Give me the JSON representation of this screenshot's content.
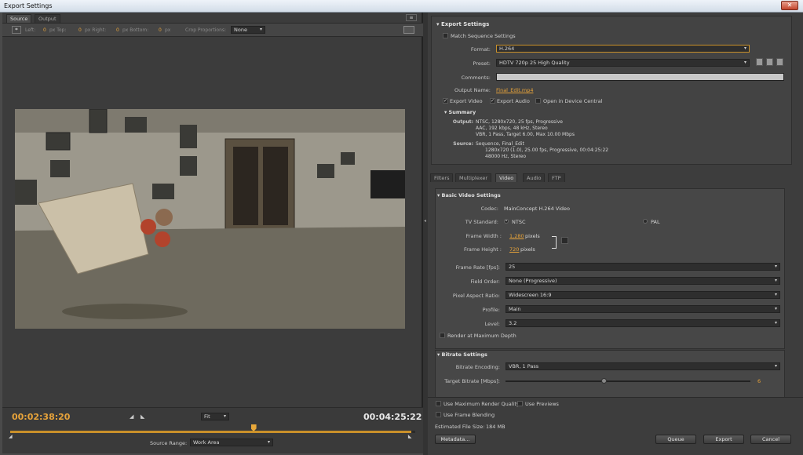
{
  "window": {
    "title": "Export Settings",
    "close": "✕"
  },
  "left": {
    "tabs": [
      "Source",
      "Output"
    ],
    "crop": {
      "left_label": "Left:",
      "left_val": "0",
      "top_label": "px  Top:",
      "top_val": "0",
      "right_label": "px  Right:",
      "right_val": "0",
      "bottom_label": "px  Bottom:",
      "bottom_val": "0",
      "unit": "px",
      "proportions_label": "Crop Proportions:",
      "proportions_val": "None"
    },
    "timecode_current": "00:02:38:20",
    "timecode_total": "00:04:25:22",
    "zoom": "Fit",
    "source_range_label": "Source Range:",
    "source_range_val": "Work Area",
    "playhead_fraction": 0.6,
    "in_fraction": 0.0,
    "out_fraction": 0.99
  },
  "export": {
    "header": "Export Settings",
    "match_sequence": "Match Sequence Settings",
    "format_label": "Format:",
    "format_val": "H.264",
    "preset_label": "Preset:",
    "preset_val": "HDTV 720p 25 High Quality",
    "comments_label": "Comments:",
    "output_name_label": "Output Name:",
    "output_name_val": "Final_Edit.mp4",
    "export_video": "Export Video",
    "export_audio": "Export Audio",
    "open_device": "Open in Device Central",
    "summary_header": "Summary",
    "output_label": "Output:",
    "output_lines": [
      "NTSC, 1280x720, 25 fps, Progressive",
      "AAC, 192 kbps, 48 kHz, Stereo",
      "VBR, 1 Pass, Target 6.00, Max 10.00 Mbps"
    ],
    "source_label": "Source:",
    "source_lines": [
      "Sequence, Final_Edit",
      "1280x720 (1.0), 25.00 fps, Progressive, 00:04:25:22",
      "48000 Hz, Stereo"
    ]
  },
  "tabs2": [
    "Filters",
    "Multiplexer",
    "Video",
    "Audio",
    "FTP"
  ],
  "video": {
    "header": "Basic Video Settings",
    "codec_label": "Codec:",
    "codec_val": "MainConcept H.264 Video",
    "tv_label": "TV Standard:",
    "ntsc": "NTSC",
    "pal": "PAL",
    "fw_label": "Frame Width :",
    "fw_val": "1,280",
    "fh_label": "Frame Height :",
    "fh_val": "720",
    "pixels": "pixels",
    "fr_label": "Frame Rate [fps]:",
    "fr_val": "25",
    "fo_label": "Field Order:",
    "fo_val": "None (Progressive)",
    "par_label": "Pixel Aspect Ratio:",
    "par_val": "Widescreen 16:9",
    "profile_label": "Profile:",
    "profile_val": "Main",
    "level_label": "Level:",
    "level_val": "3.2",
    "render_max": "Render at Maximum Depth"
  },
  "bitrate": {
    "header": "Bitrate Settings",
    "enc_label": "Bitrate Encoding:",
    "enc_val": "VBR, 1 Pass",
    "target_label": "Target Bitrate [Mbps]:",
    "target_val": "6",
    "target_fraction": 0.4
  },
  "bottom": {
    "max_quality": "Use Maximum Render Quality",
    "use_previews": "Use Previews",
    "frame_blend": "Use Frame Blending",
    "est_label": "Estimated File Size:",
    "est_val": "184 MB",
    "metadata": "Metadata...",
    "queue": "Queue",
    "export": "Export",
    "cancel": "Cancel"
  }
}
